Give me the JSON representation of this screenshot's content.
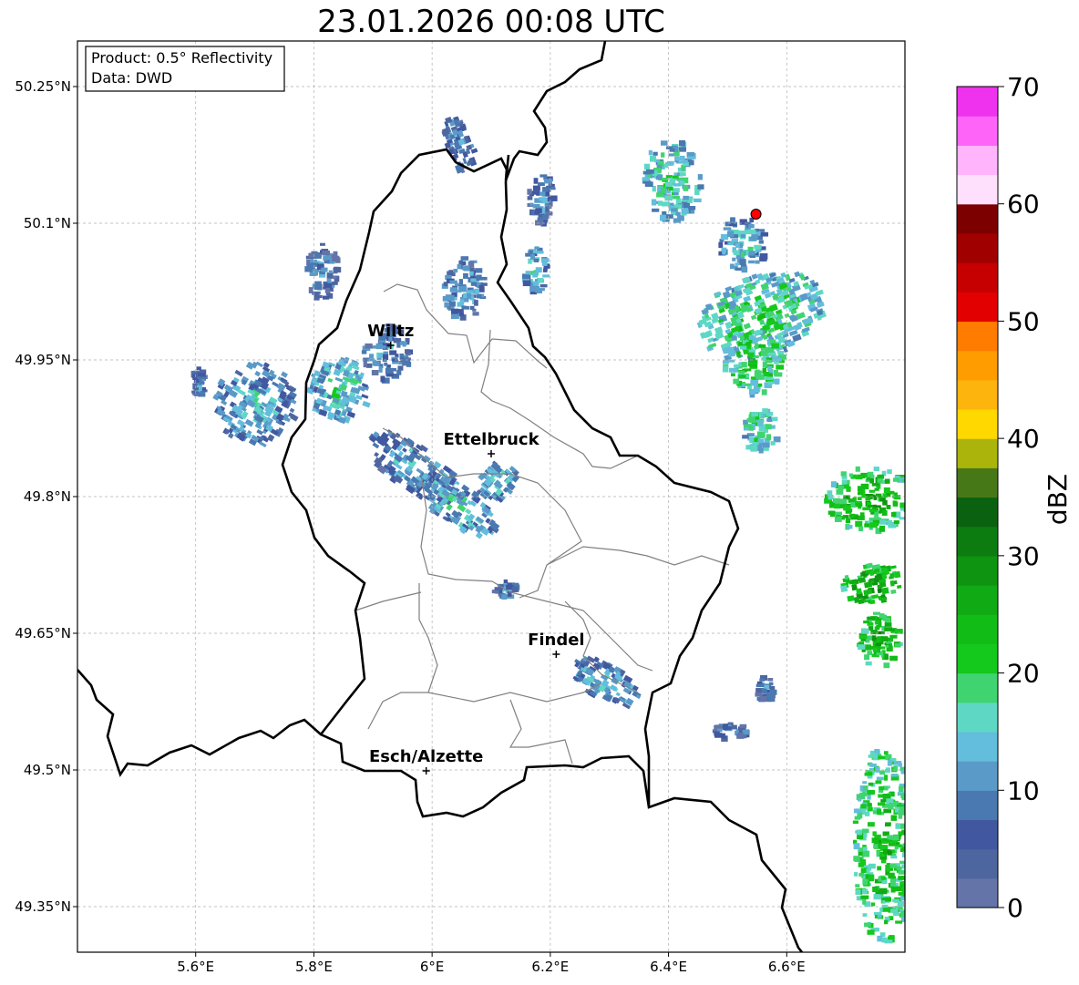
{
  "title": "23.01.2026 00:08 UTC",
  "info_box": {
    "line1": "Product: 0.5° Reflectivity",
    "line2": "Data: DWD"
  },
  "map": {
    "lon_range": [
      5.4,
      6.8
    ],
    "lat_range": [
      49.3,
      50.3
    ],
    "x_ticks": [
      {
        "value": 5.6,
        "label": "5.6°E"
      },
      {
        "value": 5.8,
        "label": "5.8°E"
      },
      {
        "value": 6.0,
        "label": "6°E"
      },
      {
        "value": 6.2,
        "label": "6.2°E"
      },
      {
        "value": 6.4,
        "label": "6.4°E"
      },
      {
        "value": 6.6,
        "label": "6.6°E"
      }
    ],
    "y_ticks": [
      {
        "value": 50.25,
        "label": "50.25°N"
      },
      {
        "value": 50.1,
        "label": "50.1°N"
      },
      {
        "value": 49.95,
        "label": "49.95°N"
      },
      {
        "value": 49.8,
        "label": "49.8°N"
      },
      {
        "value": 49.65,
        "label": "49.65°N"
      },
      {
        "value": 49.5,
        "label": "49.5°N"
      },
      {
        "value": 49.35,
        "label": "49.35°N"
      }
    ],
    "grid": true,
    "cities": [
      {
        "name": "Wiltz",
        "lon": 5.93,
        "lat": 49.966
      },
      {
        "name": "Ettelbruck",
        "lon": 6.1,
        "lat": 49.847
      },
      {
        "name": "Findel",
        "lon": 6.21,
        "lat": 49.627
      },
      {
        "name": "Esch/Alzette",
        "lon": 5.99,
        "lat": 49.499
      }
    ],
    "radar_site": {
      "lon": 6.548,
      "lat": 50.11,
      "color": "#ff0000"
    }
  },
  "colorbar": {
    "label": "dBZ",
    "min": 0,
    "max": 70,
    "tick_labels": [
      "0",
      "10",
      "20",
      "30",
      "40",
      "50",
      "60",
      "70"
    ],
    "colors": [
      "#6474a8",
      "#4e66a0",
      "#4158a0",
      "#4a78b0",
      "#5a9ac8",
      "#62bedc",
      "#5ed8c4",
      "#40d470",
      "#14c81c",
      "#12bc16",
      "#10aa14",
      "#0e9410",
      "#0c7c10",
      "#0a6210",
      "#477818",
      "#aab40a",
      "#ffd800",
      "#fdb40c",
      "#ff9d00",
      "#ff7c00",
      "#e30000",
      "#c60000",
      "#a10000",
      "#7d0000",
      "#ffe0fc",
      "#ffb4fc",
      "#ff64f8",
      "#ee32ee"
    ]
  },
  "echo_cells": [
    {
      "lon": 5.7,
      "lat": 49.905,
      "rx": 0.07,
      "ry": 0.045,
      "rot": 30,
      "dbz": 12
    },
    {
      "lon": 5.84,
      "lat": 49.92,
      "rx": 0.05,
      "ry": 0.035,
      "rot": 20,
      "dbz": 15
    },
    {
      "lon": 5.92,
      "lat": 49.96,
      "rx": 0.04,
      "ry": 0.03,
      "rot": 0,
      "dbz": 10
    },
    {
      "lon": 5.97,
      "lat": 49.835,
      "rx": 0.09,
      "ry": 0.025,
      "rot": 35,
      "dbz": 12
    },
    {
      "lon": 6.04,
      "lat": 49.795,
      "rx": 0.08,
      "ry": 0.022,
      "rot": 35,
      "dbz": 14
    },
    {
      "lon": 5.81,
      "lat": 50.05,
      "rx": 0.03,
      "ry": 0.03,
      "rot": 0,
      "dbz": 9
    },
    {
      "lon": 6.05,
      "lat": 50.03,
      "rx": 0.035,
      "ry": 0.035,
      "rot": 0,
      "dbz": 11
    },
    {
      "lon": 6.05,
      "lat": 50.19,
      "rx": 0.05,
      "ry": 0.015,
      "rot": 70,
      "dbz": 9
    },
    {
      "lon": 6.17,
      "lat": 50.05,
      "rx": 0.02,
      "ry": 0.025,
      "rot": 0,
      "dbz": 14
    },
    {
      "lon": 6.18,
      "lat": 50.13,
      "rx": 0.02,
      "ry": 0.03,
      "rot": 0,
      "dbz": 9
    },
    {
      "lon": 6.4,
      "lat": 50.15,
      "rx": 0.05,
      "ry": 0.045,
      "rot": 0,
      "dbz": 16
    },
    {
      "lon": 6.52,
      "lat": 50.08,
      "rx": 0.04,
      "ry": 0.03,
      "rot": 0,
      "dbz": 14
    },
    {
      "lon": 6.55,
      "lat": 50.0,
      "rx": 0.11,
      "ry": 0.045,
      "rot": -20,
      "dbz": 18
    },
    {
      "lon": 6.54,
      "lat": 49.95,
      "rx": 0.05,
      "ry": 0.035,
      "rot": 0,
      "dbz": 21
    },
    {
      "lon": 6.55,
      "lat": 49.875,
      "rx": 0.03,
      "ry": 0.025,
      "rot": 0,
      "dbz": 18
    },
    {
      "lon": 6.735,
      "lat": 49.8,
      "rx": 0.075,
      "ry": 0.035,
      "rot": 0,
      "dbz": 24
    },
    {
      "lon": 6.74,
      "lat": 49.705,
      "rx": 0.05,
      "ry": 0.022,
      "rot": -10,
      "dbz": 26
    },
    {
      "lon": 6.75,
      "lat": 49.645,
      "rx": 0.035,
      "ry": 0.03,
      "rot": 0,
      "dbz": 25
    },
    {
      "lon": 6.29,
      "lat": 49.6,
      "rx": 0.065,
      "ry": 0.02,
      "rot": 30,
      "dbz": 12
    },
    {
      "lon": 6.76,
      "lat": 49.42,
      "rx": 0.05,
      "ry": 0.11,
      "rot": 0,
      "dbz": 22
    },
    {
      "lon": 6.5,
      "lat": 49.545,
      "rx": 0.03,
      "ry": 0.008,
      "rot": 0,
      "dbz": 10
    },
    {
      "lon": 6.56,
      "lat": 49.59,
      "rx": 0.015,
      "ry": 0.015,
      "rot": 0,
      "dbz": 8
    },
    {
      "lon": 6.12,
      "lat": 49.7,
      "rx": 0.02,
      "ry": 0.01,
      "rot": 0,
      "dbz": 9
    },
    {
      "lon": 5.6,
      "lat": 49.93,
      "rx": 0.01,
      "ry": 0.02,
      "rot": 0,
      "dbz": 9
    },
    {
      "lon": 6.11,
      "lat": 49.82,
      "rx": 0.03,
      "ry": 0.025,
      "rot": 40,
      "dbz": 13
    }
  ]
}
